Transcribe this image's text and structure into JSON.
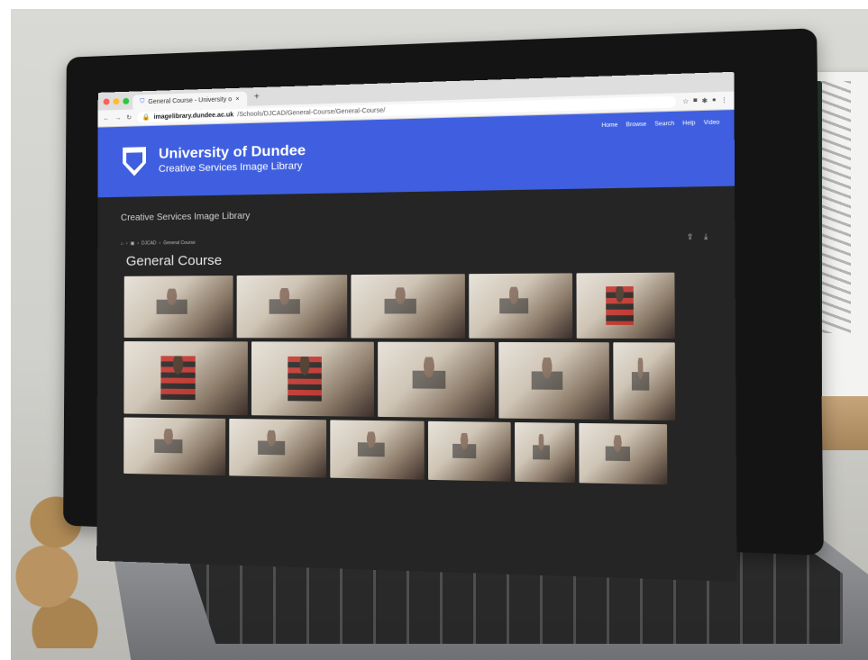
{
  "browser": {
    "tab_title": "General Course - University o",
    "tab_close": "×",
    "new_tab": "+",
    "url_domain": "imagelibrary.dundee.ac.uk",
    "url_path": "/Schools/DJCAD/General-Course/General-Course/"
  },
  "site": {
    "brand_title": "University of Dundee",
    "brand_subtitle": "Creative Services Image Library",
    "nav": [
      "Home",
      "Browse",
      "Search",
      "Help",
      "Video"
    ]
  },
  "content": {
    "library_title": "Creative Services Image Library",
    "breadcrumb": [
      "DJCAD",
      "General Course"
    ],
    "page_title": "General Course"
  },
  "photos": {
    "row1": [
      {
        "name": "photo-studio-group",
        "style": "plain"
      },
      {
        "name": "photo-student-drawing",
        "style": "plain"
      },
      {
        "name": "photo-student-table",
        "style": "plain"
      },
      {
        "name": "photo-student-painting-blue",
        "style": "plain"
      },
      {
        "name": "photo-student-red-striped",
        "style": "red"
      }
    ],
    "row2": [
      {
        "name": "photo-red-striped-wall",
        "style": "red"
      },
      {
        "name": "photo-red-striped-side",
        "style": "red"
      },
      {
        "name": "photo-student-desk",
        "style": "plain"
      },
      {
        "name": "photo-student-board",
        "style": "plain"
      },
      {
        "name": "photo-student-small",
        "style": "plain"
      }
    ],
    "row3": [
      {
        "name": "photo-group-painting",
        "style": "plain"
      },
      {
        "name": "photo-two-students",
        "style": "plain"
      },
      {
        "name": "photo-student-paint",
        "style": "plain"
      },
      {
        "name": "photo-students-standing",
        "style": "plain"
      },
      {
        "name": "photo-students-room",
        "style": "plain"
      },
      {
        "name": "photo-student-studio",
        "style": "plain"
      }
    ]
  }
}
